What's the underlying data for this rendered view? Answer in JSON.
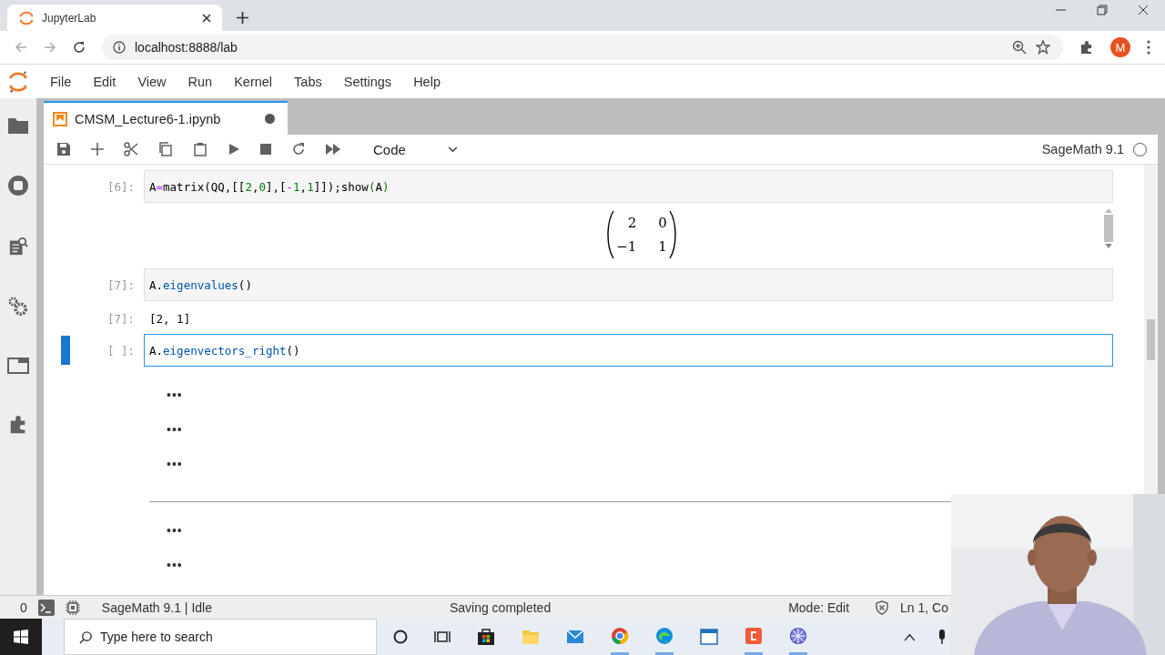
{
  "browser": {
    "tab_title": "JupyterLab",
    "url": "localhost:8888/lab",
    "profile_initial": "M"
  },
  "menu": [
    "File",
    "Edit",
    "View",
    "Run",
    "Kernel",
    "Tabs",
    "Settings",
    "Help"
  ],
  "sidebar": [
    {
      "kind": "folder"
    },
    {
      "kind": "running"
    },
    {
      "kind": "inspector"
    },
    {
      "kind": "commands"
    },
    {
      "kind": "tabs"
    },
    {
      "kind": "extensions"
    }
  ],
  "document_tab": {
    "title": "CMSM_Lecture6-1.ipynb",
    "unsaved": true
  },
  "toolbar": {
    "cell_type": "Code",
    "kernel_name": "SageMath 9.1",
    "kernel_busy": false
  },
  "cells": [
    {
      "prompt": "[6]:",
      "selected": false,
      "code": [
        {
          "t": "A",
          "kind": "plain"
        },
        {
          "t": "=",
          "kind": "op"
        },
        {
          "t": "matrix(QQ,[[",
          "kind": "plain"
        },
        {
          "t": "2",
          "kind": "num"
        },
        {
          "t": ",",
          "kind": "plain"
        },
        {
          "t": "0",
          "kind": "num"
        },
        {
          "t": "],[",
          "kind": "plain"
        },
        {
          "t": "-",
          "kind": "op"
        },
        {
          "t": "1",
          "kind": "num"
        },
        {
          "t": ",",
          "kind": "plain"
        },
        {
          "t": "1",
          "kind": "num"
        },
        {
          "t": "]]);show",
          "kind": "plain"
        },
        {
          "t": "(",
          "kind": "paren"
        },
        {
          "t": "A",
          "kind": "plain"
        },
        {
          "t": ")",
          "kind": "paren"
        }
      ],
      "output": {
        "kind": "matrix",
        "rows": [
          [
            "2",
            "0"
          ],
          [
            "−1",
            "1"
          ]
        ]
      }
    },
    {
      "prompt": "[7]:",
      "selected": false,
      "code": [
        {
          "t": "A.",
          "kind": "plain"
        },
        {
          "t": "eigenvalues",
          "kind": "attr"
        },
        {
          "t": "()",
          "kind": "plain"
        }
      ],
      "output": {
        "kind": "text",
        "prompt": "[7]:",
        "text": "[2, 1]"
      }
    },
    {
      "prompt": "[ ]:",
      "selected": true,
      "code": [
        {
          "t": "A.",
          "kind": "plain"
        },
        {
          "t": "eigenvectors_right",
          "kind": "attr"
        },
        {
          "t": "()",
          "kind": "plain"
        }
      ]
    }
  ],
  "collapsed_cells": [
    {
      "marker": "•••",
      "divider_after": false
    },
    {
      "marker": "•••",
      "divider_after": false
    },
    {
      "marker": "•••",
      "divider_after": true
    },
    {
      "marker": "•••",
      "divider_after": false
    },
    {
      "marker": "•••",
      "divider_after": false
    }
  ],
  "status_bar": {
    "terminals": "0",
    "kernel_status": "SageMath 9.1 | Idle",
    "message": "Saving completed",
    "mode": "Mode: Edit",
    "position": "Ln 1, Co"
  },
  "taskbar": {
    "search_placeholder": "Type here to search"
  }
}
